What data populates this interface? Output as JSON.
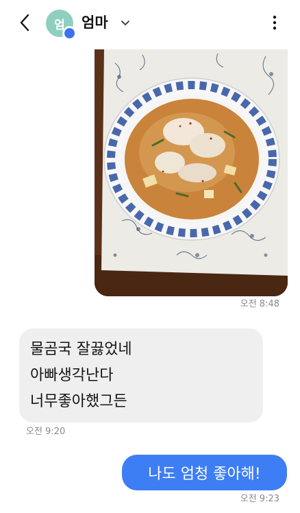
{
  "header": {
    "contact_name": "엄마",
    "avatar_initial": "엄",
    "back_icon": "chevron-left-icon",
    "dropdown_icon": "chevron-down-icon",
    "more_icon": "more-vertical-icon"
  },
  "messages": [
    {
      "type": "image",
      "direction": "outgoing",
      "timestamp": "오전 8:48"
    },
    {
      "type": "text",
      "direction": "incoming",
      "lines": [
        "물곰국 잘끓었네",
        "아빠생각난다",
        "너무좋아했그든"
      ],
      "timestamp": "오전 9:20"
    },
    {
      "type": "text",
      "direction": "outgoing",
      "lines": [
        "나도 엄청 좋아해!"
      ],
      "timestamp": "오전 9:23"
    }
  ],
  "colors": {
    "avatar_bg": "#8ecfbf",
    "badge": "#3a72f0",
    "outgoing_bubble": "#3d7ef5",
    "incoming_bubble": "#efefef",
    "timestamp": "#888888"
  }
}
